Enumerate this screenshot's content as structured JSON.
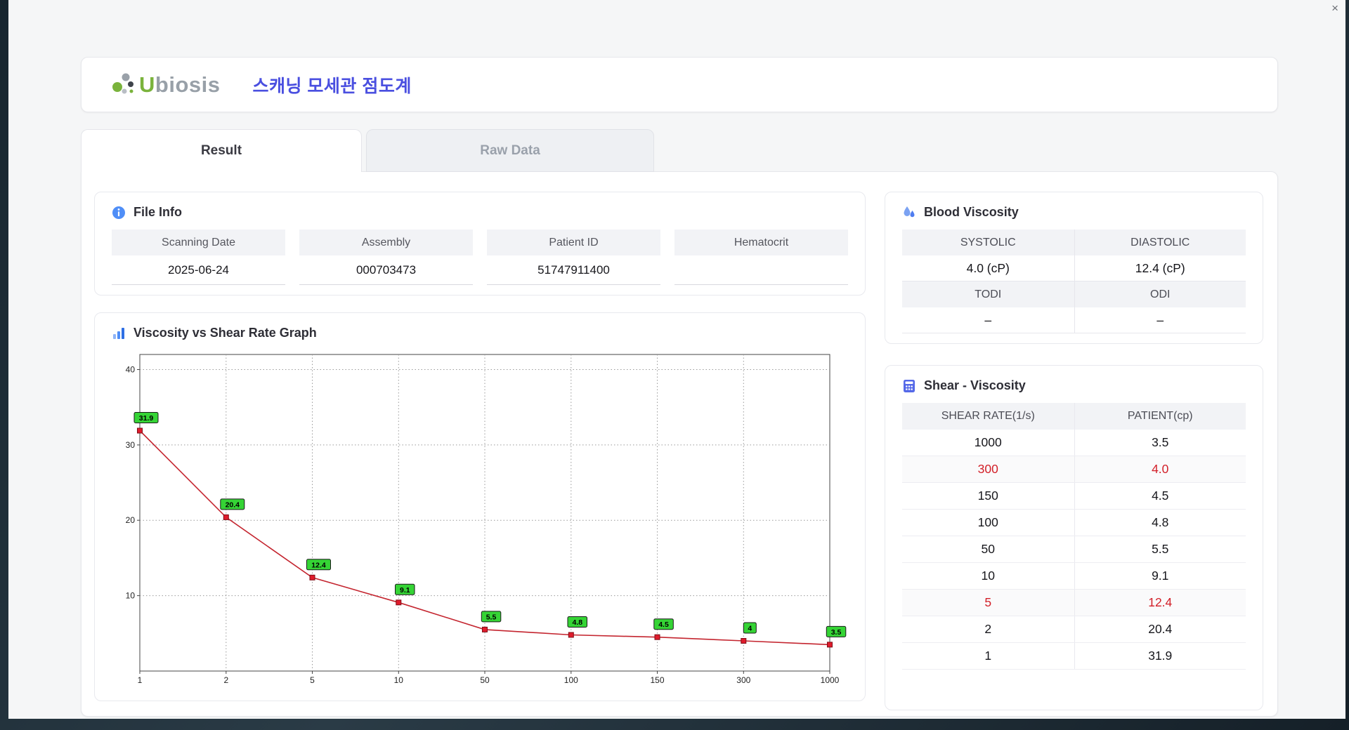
{
  "window": {
    "close": "×"
  },
  "header": {
    "logo": {
      "u": "U",
      "rest": "biosis"
    },
    "title": "스캐닝 모세관 점도계"
  },
  "tabs": [
    {
      "label": "Result",
      "active": true
    },
    {
      "label": "Raw Data",
      "active": false
    }
  ],
  "icons": {
    "file_info": "info-icon",
    "graph": "bar-chart-icon",
    "blood": "droplet-icon",
    "shear": "calculator-icon",
    "close": "close-icon",
    "logo": "dots-logo-icon"
  },
  "file_info": {
    "title": "File Info",
    "fields": [
      {
        "label": "Scanning Date",
        "value": "2025-06-24"
      },
      {
        "label": "Assembly",
        "value": "000703473"
      },
      {
        "label": "Patient ID",
        "value": "51747911400"
      },
      {
        "label": "Hematocrit",
        "value": ""
      }
    ]
  },
  "blood_viscosity": {
    "title": "Blood Viscosity",
    "rows": [
      {
        "labels": [
          "SYSTOLIC",
          "DIASTOLIC"
        ],
        "values": [
          "4.0 (cP)",
          "12.4 (cP)"
        ]
      },
      {
        "labels": [
          "TODI",
          "ODI"
        ],
        "values": [
          "–",
          "–"
        ]
      }
    ]
  },
  "shear_viscosity": {
    "title": "Shear - Viscosity",
    "columns": [
      "SHEAR RATE(1/s)",
      "PATIENT(cp)"
    ],
    "rows": [
      {
        "shear": "1000",
        "patient": "3.5",
        "highlight": false
      },
      {
        "shear": "300",
        "patient": "4.0",
        "highlight": true
      },
      {
        "shear": "150",
        "patient": "4.5",
        "highlight": false
      },
      {
        "shear": "100",
        "patient": "4.8",
        "highlight": false
      },
      {
        "shear": "50",
        "patient": "5.5",
        "highlight": false
      },
      {
        "shear": "10",
        "patient": "9.1",
        "highlight": false
      },
      {
        "shear": "5",
        "patient": "12.4",
        "highlight": true
      },
      {
        "shear": "2",
        "patient": "20.4",
        "highlight": false
      },
      {
        "shear": "1",
        "patient": "31.9",
        "highlight": false
      }
    ]
  },
  "chart_data": {
    "type": "line",
    "title": "Viscosity vs Shear Rate Graph",
    "x": [
      1,
      2,
      5,
      10,
      50,
      100,
      150,
      300,
      1000
    ],
    "y": [
      31.9,
      20.4,
      12.4,
      9.1,
      5.5,
      4.8,
      4.5,
      4.0,
      3.5
    ],
    "point_labels": [
      "31.9",
      "20.4",
      "12.4",
      "9.1",
      "5.5",
      "4.8",
      "4.5",
      "4",
      "3.5"
    ],
    "x_tick_labels": [
      "1",
      "2",
      "5",
      "10",
      "50",
      "100",
      "150",
      "300",
      "1000"
    ],
    "x_spacing": "even",
    "y_ticks": [
      10,
      20,
      30,
      40
    ],
    "ylim": [
      0,
      42
    ],
    "grid": "dotted",
    "legend": "none",
    "xlabel": "",
    "ylabel": "",
    "line_color": "#c4252f",
    "marker_fill": "#e01b2c",
    "marker_stroke": "#7e0d16",
    "label_bg": "#35d435",
    "label_border": "#1a1a1a"
  }
}
